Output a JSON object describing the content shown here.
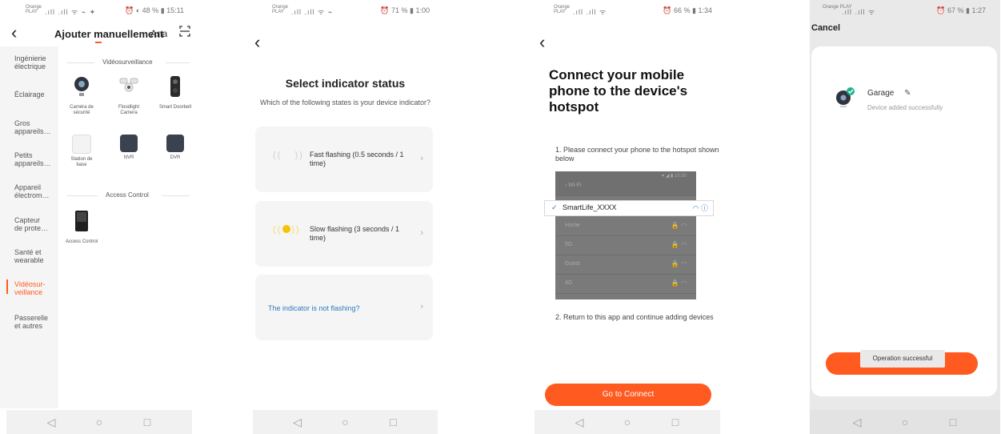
{
  "screen1": {
    "status": {
      "carrier": "Orange\nPLAY",
      "signal": ".ıll .ıll ᯤ ⌁ ✦",
      "right": "⏰ ◐ 48 % ▮ 15:11"
    },
    "title": "Ajouter manuellement",
    "tab_partial": "Ana",
    "sidebar": [
      "Ingénierie\nélectrique",
      "Éclairage",
      "Gros\nappareils…",
      "Petits\nappareils…",
      "Appareil\nélectrom…",
      "Capteur\nde prote…",
      "Santé et\nwearable",
      "Vidéosur-\nveillance",
      "Passerelle\net autres"
    ],
    "section1": "Vidéosurveillance",
    "devices1": [
      "Caméra de\nsécurité",
      "Floodlight\nCamera",
      "Smart Doorbell",
      "Station de\nbase",
      "NVR",
      "DVR"
    ],
    "section2": "Access Control",
    "devices2": [
      "Access Control"
    ]
  },
  "screen2": {
    "status": {
      "carrier": "Orange\nPLAY",
      "signal": ".ıll .ıll ᯤ ⌁",
      "right": "⏰ 71 % ▮ 1:00"
    },
    "heading": "Select indicator status",
    "subheading": "Which of the following states is your device indicator?",
    "options": [
      "Fast flashing (0.5 seconds / 1 time)",
      "Slow flashing (3 seconds / 1 time)"
    ],
    "not_flashing": "The indicator is not flashing?"
  },
  "screen3": {
    "status": {
      "carrier": "Orange\nPLAY",
      "signal": ".ıll .ıll ᯤ",
      "right": "⏰ 66 % ▮ 1:34"
    },
    "heading": "Connect your mobile phone to the device's hotspot",
    "step1": "1. Please connect your phone to the hotspot shown below",
    "wifi_header": "Wi-Fi",
    "wifi_time": "▾ ◢ ▮ 10:30",
    "wifi_selected": "SmartLife_XXXX",
    "wifi_networks": [
      "Home",
      "5G",
      "Guest",
      "4G"
    ],
    "step2": "2. Return to this app and continue adding devices",
    "button": "Go to Connect"
  },
  "screen4": {
    "status": {
      "carrier": "Orange\nPLAY",
      "signal": ".ıll .ıll ᯤ",
      "right": "⏰ 67 % ▮ 1:27"
    },
    "cancel": "Cancel",
    "device_name": "Garage",
    "device_status": "Device added successfully",
    "toast": "Operation successful"
  },
  "accent": "#ff5a1f",
  "link_color": "#2f7bbd"
}
